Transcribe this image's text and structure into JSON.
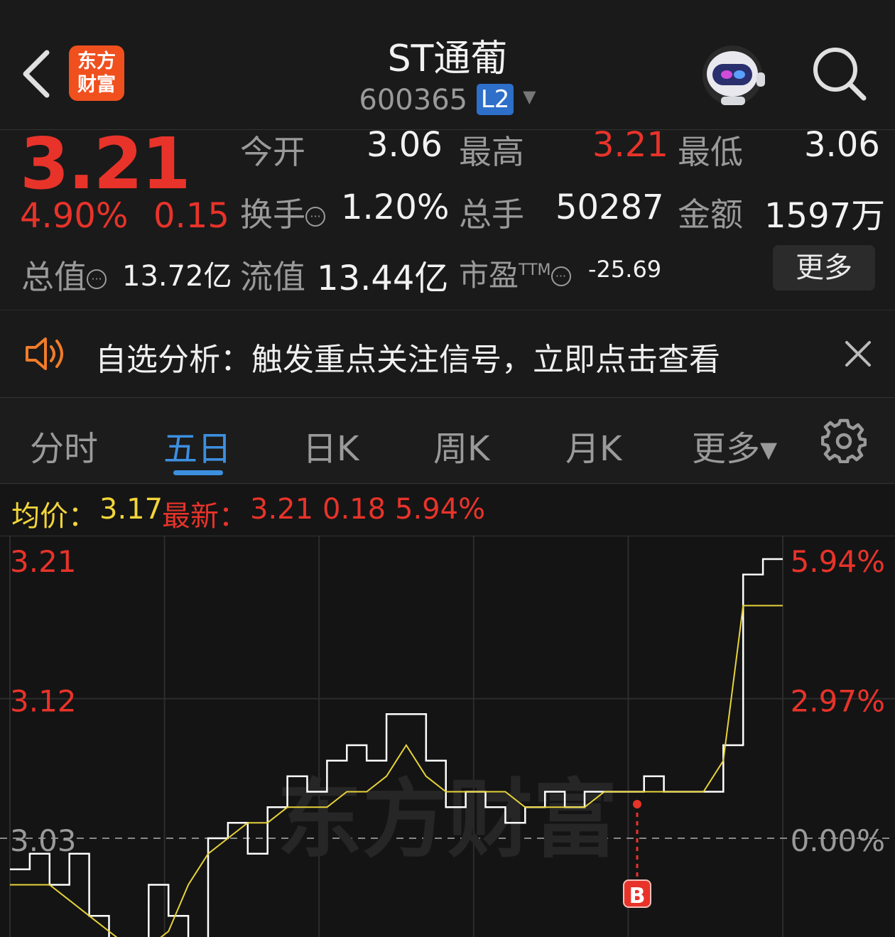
{
  "header": {
    "logo_line1": "东方",
    "logo_line2": "财富",
    "stock_name": "ST通葡",
    "stock_code": "600365",
    "level_badge": "L2"
  },
  "quote": {
    "price": "3.21",
    "change_pct": "4.90%",
    "change": "0.15",
    "fields": {
      "open_label": "今开",
      "open_value": "3.06",
      "high_label": "最高",
      "high_value": "3.21",
      "low_label": "最低",
      "low_value": "3.06",
      "turnover_label": "换手",
      "turnover_value": "1.20%",
      "volume_label": "总手",
      "volume_value": "50287",
      "amount_label": "金额",
      "amount_value": "1597万",
      "mktcap_label": "总值",
      "mktcap_value": "13.72亿",
      "float_label": "流值",
      "float_value": "13.44亿",
      "pe_label": "市盈",
      "pe_sup": "TTM",
      "pe_value": "-25.69"
    },
    "more_label": "更多"
  },
  "notice": {
    "text": "自选分析：触发重点关注信号，立即点击查看"
  },
  "tabs": [
    {
      "label": "分时"
    },
    {
      "label": "五日"
    },
    {
      "label": "日K"
    },
    {
      "label": "周K"
    },
    {
      "label": "月K"
    },
    {
      "label": "更多▾"
    }
  ],
  "active_tab": "五日",
  "legend": {
    "avg_label": "均价：",
    "avg_value": "3.17",
    "latest_label": "最新：",
    "latest_value": "3.21",
    "latest_change": "0.18",
    "latest_pct": "5.94%"
  },
  "chart_data": {
    "type": "line",
    "y_left_ticks": [
      "3.21",
      "3.12",
      "3.03"
    ],
    "y_right_ticks": [
      "5.94%",
      "2.97%",
      "0.00%"
    ],
    "ylim": [
      2.96,
      3.21
    ],
    "baseline": 3.03,
    "days": 5,
    "watermark": "东方财富",
    "signal_marker": "B",
    "series": [
      {
        "color": "#ffffff",
        "values": [
          3.01,
          3.02,
          3.0,
          3.02,
          2.98,
          2.96,
          2.94,
          3.0,
          2.98,
          2.95,
          3.03,
          3.04,
          3.02,
          3.05,
          3.07,
          3.06,
          3.08,
          3.09,
          3.08,
          3.11,
          3.11,
          3.08,
          3.05,
          3.06,
          3.05,
          3.04,
          3.05,
          3.06,
          3.05,
          3.06,
          3.06,
          3.06,
          3.07,
          3.06,
          3.06,
          3.06,
          3.09,
          3.2,
          3.21,
          3.21
        ]
      },
      {
        "color": "#e6d23a",
        "values": [
          3.0,
          3.0,
          3.0,
          2.99,
          2.98,
          2.97,
          2.96,
          2.96,
          2.97,
          3.0,
          3.02,
          3.03,
          3.04,
          3.04,
          3.05,
          3.05,
          3.05,
          3.06,
          3.06,
          3.07,
          3.09,
          3.07,
          3.06,
          3.06,
          3.06,
          3.06,
          3.05,
          3.05,
          3.05,
          3.05,
          3.06,
          3.06,
          3.06,
          3.06,
          3.06,
          3.06,
          3.08,
          3.18,
          3.18,
          3.18
        ]
      }
    ]
  }
}
